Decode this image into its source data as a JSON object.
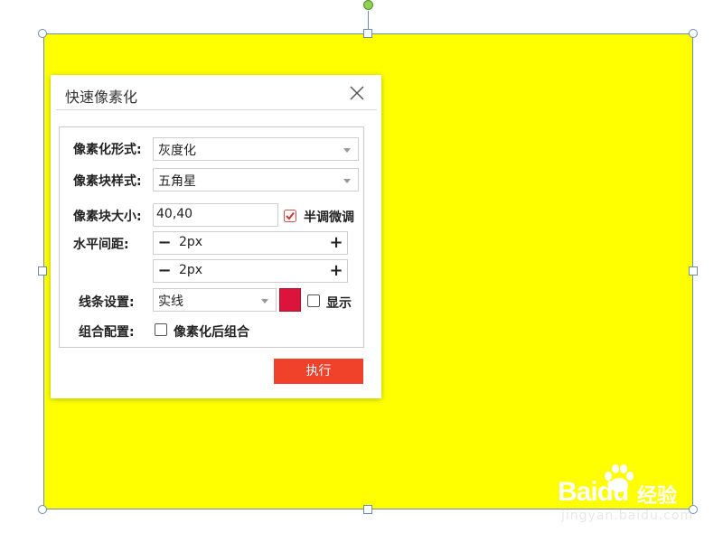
{
  "dialog": {
    "title": "快速像素化",
    "style_label": "像素化形式:",
    "style_value": "灰度化",
    "block_style_label": "像素块样式:",
    "block_style_value": "五角星",
    "block_size_label": "像素块大小:",
    "block_size_value": "40,40",
    "fine_tune_label": "半调微调",
    "fine_tune_checked": true,
    "h_spacing_label": "水平间距:",
    "h_spacing_value": "2px",
    "v_spacing_value": "2px",
    "minus_glyph": "−",
    "plus_glyph": "+",
    "line_label": "线条设置:",
    "line_value": "实线",
    "line_color": "#dc143c",
    "show_label": "显示",
    "show_checked": false,
    "group_label": "组合配置:",
    "group_option_label": "像素化后组合",
    "group_checked": false,
    "execute_label": "执行"
  },
  "canvas": {
    "shape_fill": "#ffff00",
    "selection_color": "#6b8db4",
    "rotate_handle_color": "#92d050"
  },
  "watermark": {
    "logo": "Baidu",
    "brand": "经验",
    "url": "jingyan.baidu.com"
  }
}
